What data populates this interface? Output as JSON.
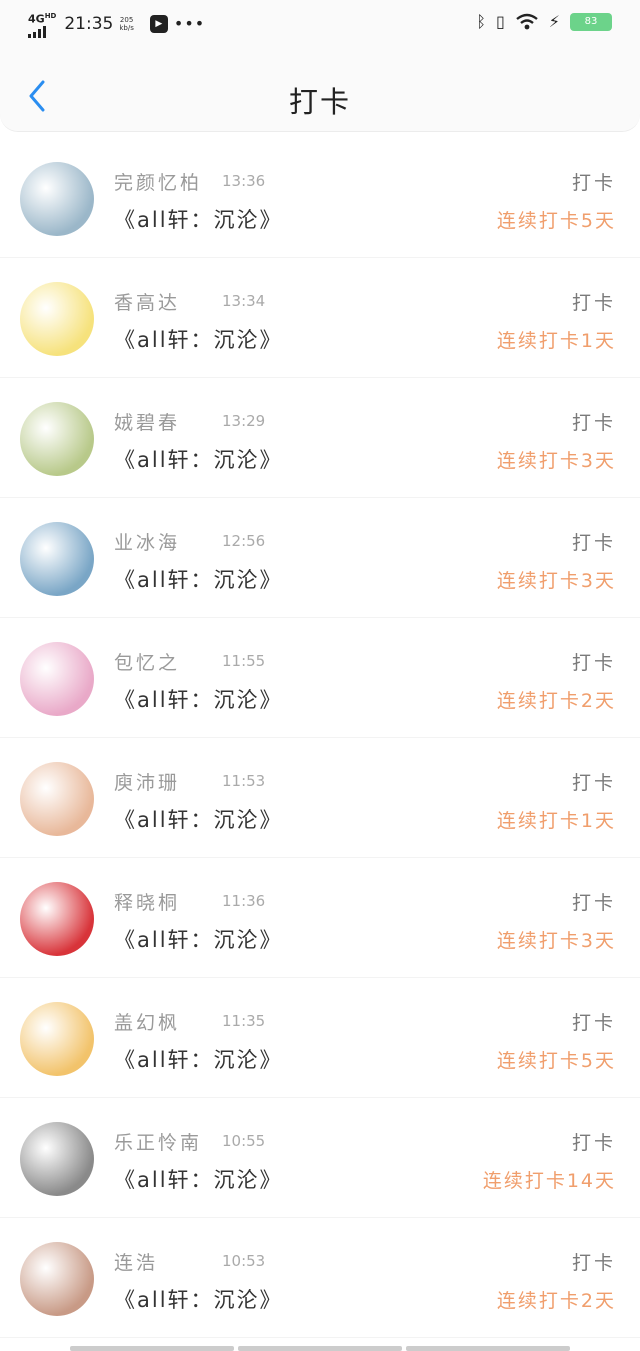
{
  "status_bar": {
    "network": "4G",
    "network_sub": "HD",
    "time": "21:35",
    "speed_value": "205",
    "speed_unit": "kb/s",
    "battery": "83"
  },
  "header": {
    "title": "打卡"
  },
  "entries": [
    {
      "name": "完颜忆柏",
      "time": "13:36",
      "book": "《all轩：沉沦》",
      "action": "打卡",
      "streak": "连续打卡5天",
      "avatar_color": "#9bb7c9"
    },
    {
      "name": "香高达",
      "time": "13:34",
      "book": "《all轩：沉沦》",
      "action": "打卡",
      "streak": "连续打卡1天",
      "avatar_color": "#f6e27c"
    },
    {
      "name": "娀碧春",
      "time": "13:29",
      "book": "《all轩：沉沦》",
      "action": "打卡",
      "streak": "连续打卡3天",
      "avatar_color": "#b8c98a"
    },
    {
      "name": "业冰海",
      "time": "12:56",
      "book": "《all轩：沉沦》",
      "action": "打卡",
      "streak": "连续打卡3天",
      "avatar_color": "#7aa6c6"
    },
    {
      "name": "包忆之",
      "time": "11:55",
      "book": "《all轩：沉沦》",
      "action": "打卡",
      "streak": "连续打卡2天",
      "avatar_color": "#e9a9c8"
    },
    {
      "name": "庾沛珊",
      "time": "11:53",
      "book": "《all轩：沉沦》",
      "action": "打卡",
      "streak": "连续打卡1天",
      "avatar_color": "#e8b89a"
    },
    {
      "name": "释晓桐",
      "time": "11:36",
      "book": "《all轩：沉沦》",
      "action": "打卡",
      "streak": "连续打卡3天",
      "avatar_color": "#d8343a"
    },
    {
      "name": "盖幻枫",
      "time": "11:35",
      "book": "《all轩：沉沦》",
      "action": "打卡",
      "streak": "连续打卡5天",
      "avatar_color": "#f2c36b"
    },
    {
      "name": "乐正怜南",
      "time": "10:55",
      "book": "《all轩：沉沦》",
      "action": "打卡",
      "streak": "连续打卡14天",
      "avatar_color": "#8a8a8a"
    },
    {
      "name": "连浩",
      "time": "10:53",
      "book": "《all轩：沉沦》",
      "action": "打卡",
      "streak": "连续打卡2天",
      "avatar_color": "#c89a86"
    }
  ]
}
